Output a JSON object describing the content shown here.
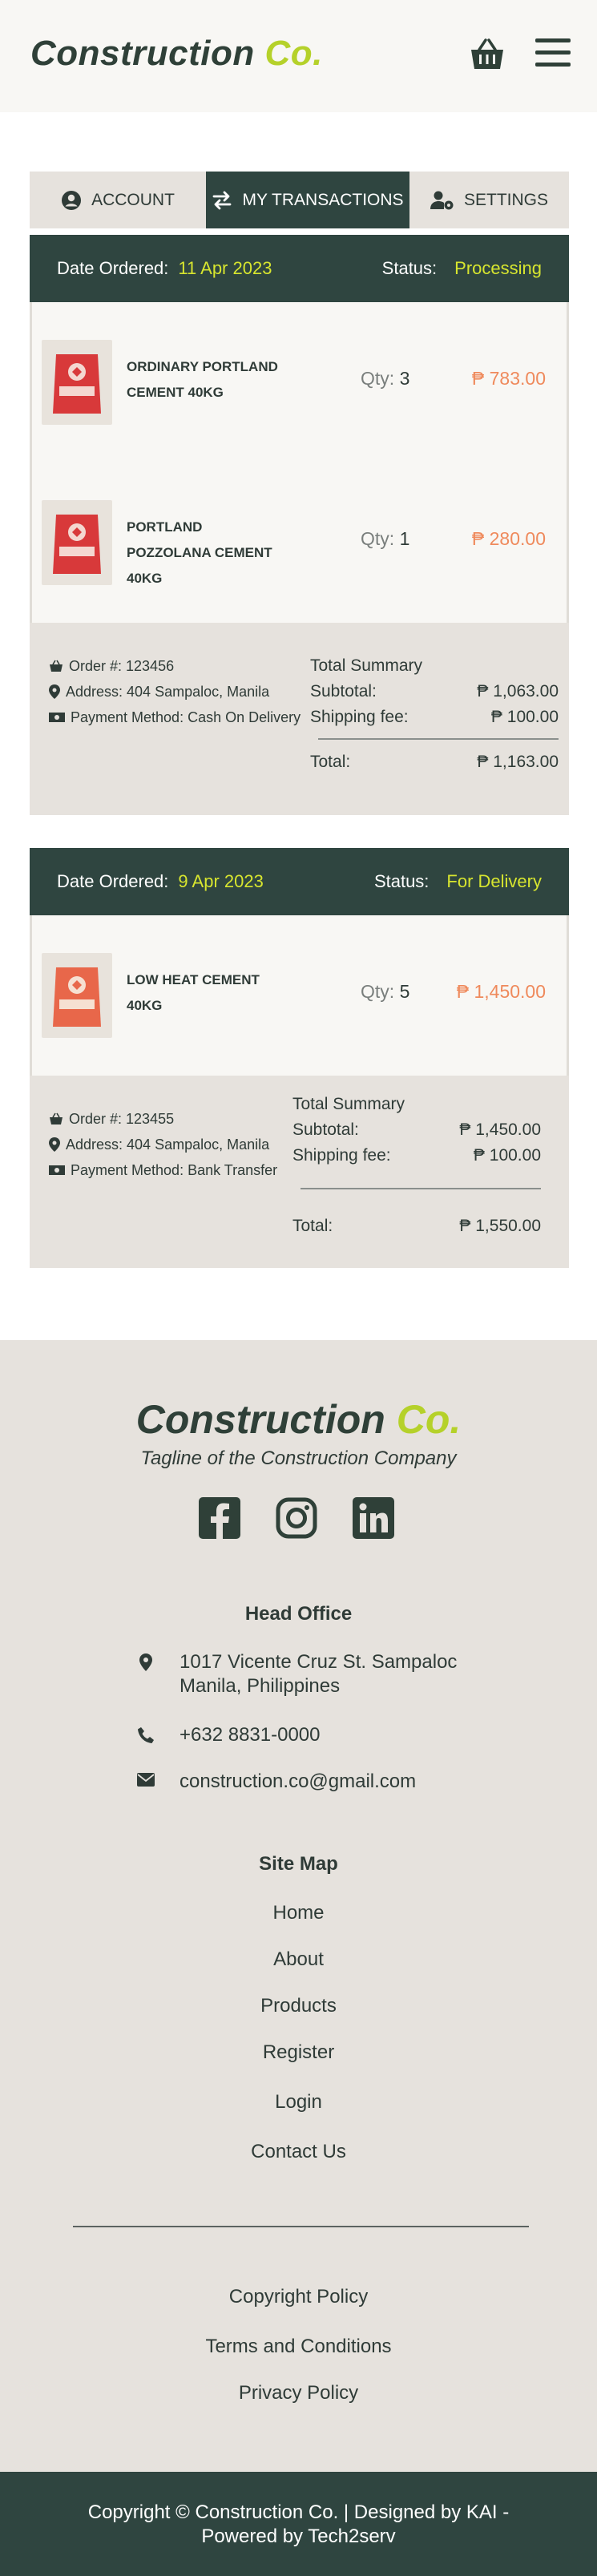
{
  "brand": {
    "name": "Construction",
    "suffix": "Co."
  },
  "tabs": [
    {
      "label": "ACCOUNT",
      "icon": "user-circle-icon"
    },
    {
      "label": "MY TRANSACTIONS",
      "icon": "exchange-icon"
    },
    {
      "label": "SETTINGS",
      "icon": "user-gear-icon"
    }
  ],
  "orders": [
    {
      "date_label": "Date Ordered:",
      "date": "11 Apr 2023",
      "status_label": "Status:",
      "status": "Processing",
      "items": [
        {
          "name": "ORDINARY PORTLAND CEMENT 40kg",
          "qty_label": "Qty:",
          "qty": "3",
          "price": "₱ 783.00"
        },
        {
          "name": "PORTLAND POZZOLANA CEMENT 40kg",
          "qty_label": "Qty:",
          "qty": "1",
          "price": "₱ 280.00"
        }
      ],
      "order_no": "Order #: 123456",
      "address": "Address: 404 Sampaloc, Manila",
      "payment": "Payment Method: Cash On Delivery",
      "summary_title": "Total Summary",
      "subtotal_label": "Subtotal:",
      "subtotal": "₱ 1,063.00",
      "shipping_label": "Shipping fee:",
      "shipping": "₱ 100.00",
      "total_label": "Total:",
      "total": "₱ 1,163.00"
    },
    {
      "date_label": "Date Ordered:",
      "date": "9 Apr 2023",
      "status_label": "Status:",
      "status": "For Delivery",
      "items": [
        {
          "name": "LOW HEAT CEMENT 40kg",
          "qty_label": "Qty:",
          "qty": "5",
          "price": "₱ 1,450.00"
        }
      ],
      "order_no": "Order #: 123455",
      "address": "Address: 404 Sampaloc, Manila",
      "payment": "Payment Method: Bank Transfer",
      "summary_title": "Total Summary",
      "subtotal_label": "Subtotal:",
      "subtotal": "₱ 1,450.00",
      "shipping_label": "Shipping fee:",
      "shipping": "₱ 100.00",
      "total_label": "Total:",
      "total": "₱ 1,550.00"
    }
  ],
  "footer": {
    "tagline": "Tagline of the Construction Company",
    "socials": [
      "facebook-icon",
      "instagram-icon",
      "linkedin-icon"
    ],
    "head_office_title": "Head Office",
    "address_line1": "1017 Vicente Cruz St. Sampaloc",
    "address_line2": "Manila, Philippines",
    "phone": "+632 8831-0000",
    "email": "construction.co@gmail.com",
    "sitemap_title": "Site Map",
    "sitemap": [
      "Home",
      "About",
      "Products",
      "Register",
      "Login",
      "Contact Us"
    ],
    "policies": [
      "Copyright Policy",
      "Terms and Conditions",
      "Privacy Policy"
    ],
    "copyright_line1": "Copyright © Construction Co.  | Designed by KAI -",
    "copyright_line2": "Powered by Tech2serv"
  },
  "colors": {
    "dark": "#2f4540",
    "accent": "#b5d12a",
    "status": "#d7e52f",
    "price": "#ef8a5c"
  }
}
